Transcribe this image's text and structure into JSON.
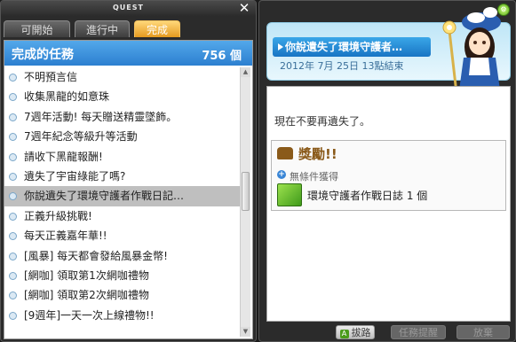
{
  "window": {
    "title": "QUEST"
  },
  "tabs": [
    {
      "label": "可開始"
    },
    {
      "label": "進行中"
    },
    {
      "label": "完成"
    }
  ],
  "list": {
    "header_title": "完成的任務",
    "count": "756 個",
    "items": [
      {
        "label": "不明預言信"
      },
      {
        "label": "收集黑龍的如意珠"
      },
      {
        "label": "7週年活動! 每天贈送精靈墜飾。"
      },
      {
        "label": "7週年紀念等級升等活動"
      },
      {
        "label": "請收下黑龍報酬!"
      },
      {
        "label": "遺失了宇宙綠能了嗎?"
      },
      {
        "label": "你說遺失了環境守護者作戰日記…"
      },
      {
        "label": "正義升級挑戰!"
      },
      {
        "label": "每天正義嘉年華!!"
      },
      {
        "label": "[風暴] 每天都會發給風暴金幣!"
      },
      {
        "label": "[網咖] 領取第1次網咖禮物"
      },
      {
        "label": "[網咖] 領取第2次網咖禮物"
      },
      {
        "label": "[9週年]一天一次上線禮物!!"
      }
    ]
  },
  "detail": {
    "title": "你說遺失了環境守護者…",
    "date": "2012年 7月 25日 13點結束",
    "description": "現在不要再遺失了。",
    "reward": {
      "title": "獎勵!!",
      "subtitle": "無條件獲得",
      "item": "環境守護者作戰日誌 1 個"
    }
  },
  "buttons": {
    "give_up": "拔路",
    "remind": "任務提醒",
    "abandon": "放棄"
  }
}
